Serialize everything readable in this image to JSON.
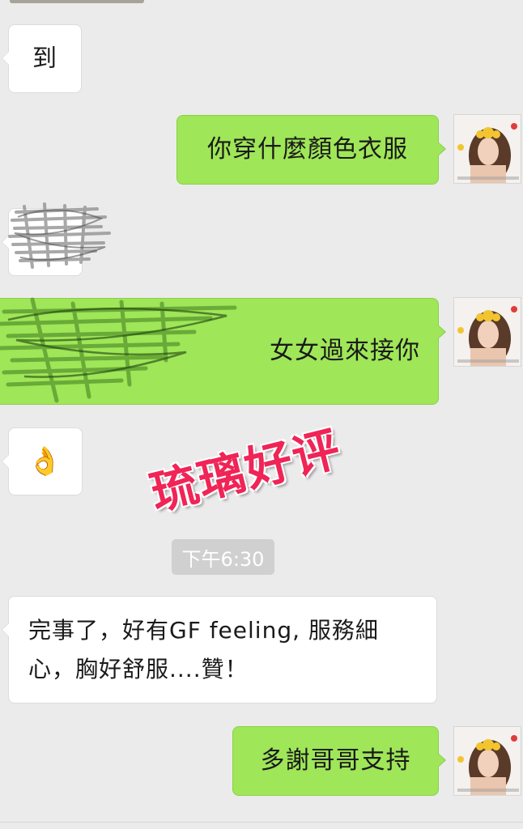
{
  "messages": [
    {
      "side": "left",
      "text": "到"
    },
    {
      "side": "right",
      "text": "你穿什麼顏色衣服"
    },
    {
      "side": "left",
      "text": ""
    },
    {
      "side": "right",
      "text": "女女過來接你"
    },
    {
      "side": "left",
      "emoji": "👌"
    },
    {
      "side": "left",
      "text": "完事了，好有GF feeling, 服務細\n心，胸好舒服....贊！"
    },
    {
      "side": "right",
      "text": "多謝哥哥支持"
    }
  ],
  "timestamp": "下午6:30",
  "watermark": "琉璃好评",
  "colors": {
    "background": "#ebebeb",
    "sent_bubble": "#9fe658",
    "received_bubble": "#ffffff",
    "watermark": "#f02456"
  },
  "icons": {
    "avatar": "contact-avatar-photo",
    "redaction": "scribble-redaction"
  }
}
